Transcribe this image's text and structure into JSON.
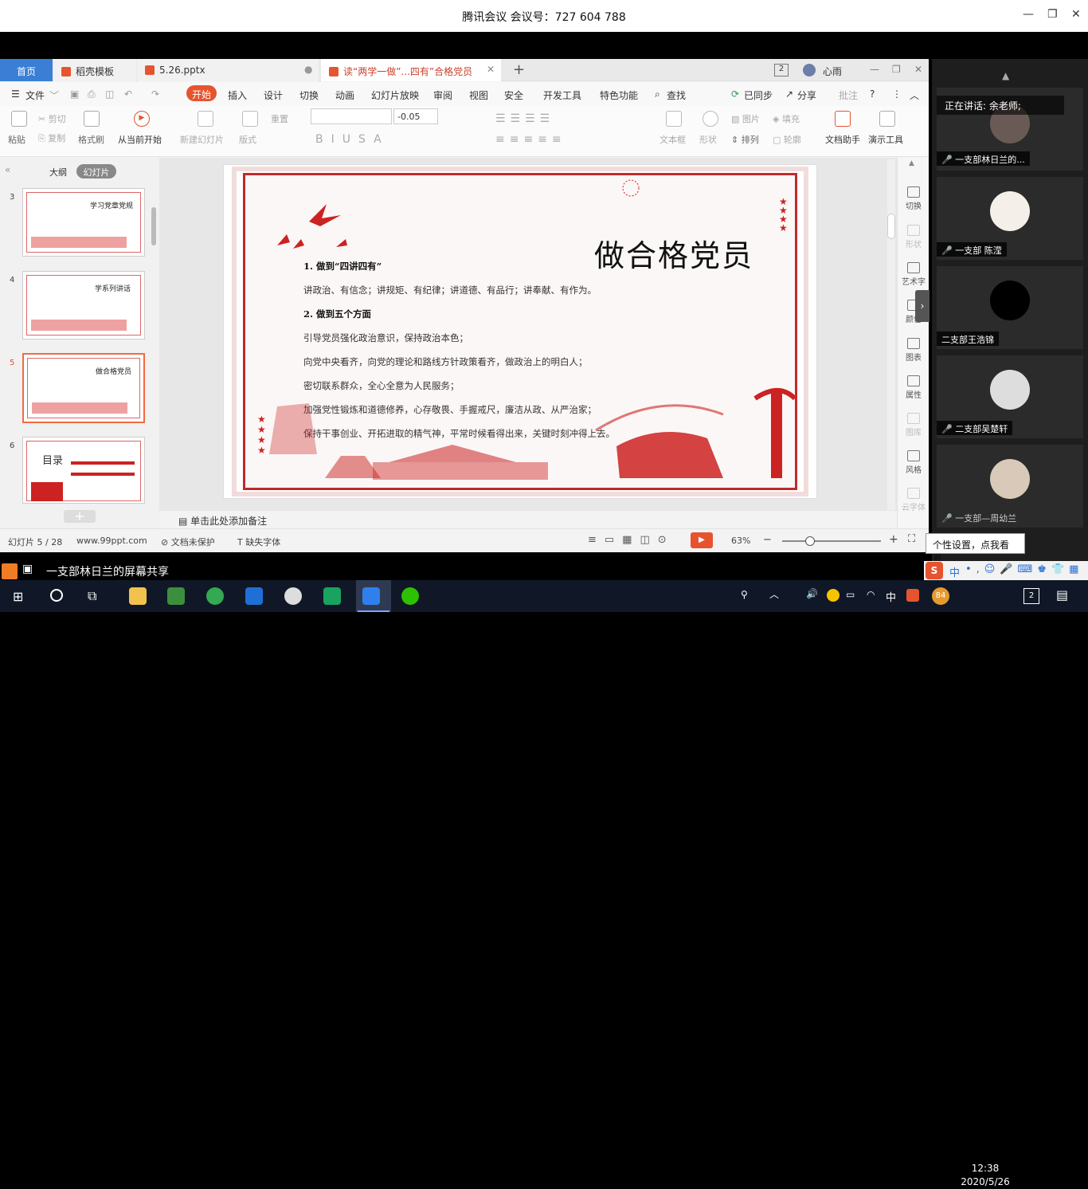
{
  "meeting": {
    "title": "腾讯会议 会议号：727 604 788"
  },
  "tabs": [
    {
      "label": "首页"
    },
    {
      "label": "稻壳模板"
    },
    {
      "label": "5.26.pptx"
    },
    {
      "label": "读“两学一做”...四有”合格党员"
    }
  ],
  "user": {
    "name": "心雨",
    "badge": "2"
  },
  "menu": {
    "file": "文件",
    "items": [
      "开始",
      "插入",
      "设计",
      "切换",
      "动画",
      "幻灯片放映",
      "审阅",
      "视图",
      "安全",
      "开发工具",
      "特色功能"
    ],
    "search": "查找",
    "sync": "已同步",
    "share": "分享",
    "comment": "批注"
  },
  "ribbon": {
    "paste": "粘贴",
    "cut": "剪切",
    "copy": "复制",
    "format_painter": "格式刷",
    "from_current": "从当前开始",
    "new_slide": "新建幻灯片",
    "layout": "版式",
    "reset": "重置",
    "font_size": "-0.05",
    "textbox": "文本框",
    "shape": "形状",
    "picture": "图片",
    "fill": "填充",
    "arrange": "排列",
    "outline": "轮廓",
    "doc_assistant": "文档助手",
    "presentation_tools": "演示工具"
  },
  "left_panel": {
    "outline": "大纲",
    "slides": "幻灯片",
    "thumbs": [
      {
        "num": "3",
        "title": "学习党章党规"
      },
      {
        "num": "4",
        "title": "学系列讲话"
      },
      {
        "num": "5",
        "title": "做合格党员"
      },
      {
        "num": "6",
        "title": "目录"
      }
    ]
  },
  "slide": {
    "title": "做合格党员",
    "lines": [
      "1. 做到“四讲四有”",
      "讲政治、有信念；讲规矩、有纪律；讲道德、有品行；讲奉献、有作为。",
      "2. 做到五个方面",
      "引导党员强化政治意识，保持政治本色；",
      "向党中央看齐，向党的理论和路线方针政策看齐，做政治上的明白人；",
      "密切联系群众，全心全意为人民服务；",
      "加强党性锻炼和道德修养，心存敬畏、手握戒尺，廉洁从政、从严治家；",
      "保持干事创业、开拓进取的精气神，平常时候看得出来，关键时刻冲得上去。"
    ]
  },
  "notes": "单击此处添加备注",
  "right_tools": [
    "切换",
    "形状",
    "艺术字",
    "颜色",
    "图表",
    "属性",
    "图库",
    "风格",
    "云字体"
  ],
  "status": {
    "slide_count": "幻灯片 5 / 28",
    "site": "www.99ppt.com",
    "protect": "文档未保护",
    "missing_font": "缺失字体",
    "zoom": "63%"
  },
  "participants": {
    "speaking": "正在讲话: 余老师;",
    "list": [
      {
        "name": "一支部林日兰的..."
      },
      {
        "name": "一支部 陈滢"
      },
      {
        "name": "二支部王浩锦"
      },
      {
        "name": "二支部吴楚轩"
      },
      {
        "name": "一支部—周幼兰"
      }
    ]
  },
  "tooltip": "个性设置，点我看看",
  "share_label": "一支部林日兰的屏幕共享",
  "taskbar": {
    "time": "12:38",
    "date": "2020/5/26",
    "ime": "中",
    "notif": "2",
    "badge84": "84"
  },
  "colors": {
    "accent": "#e5542f",
    "party_red": "#c02a2a",
    "taskbar": "#101828"
  }
}
